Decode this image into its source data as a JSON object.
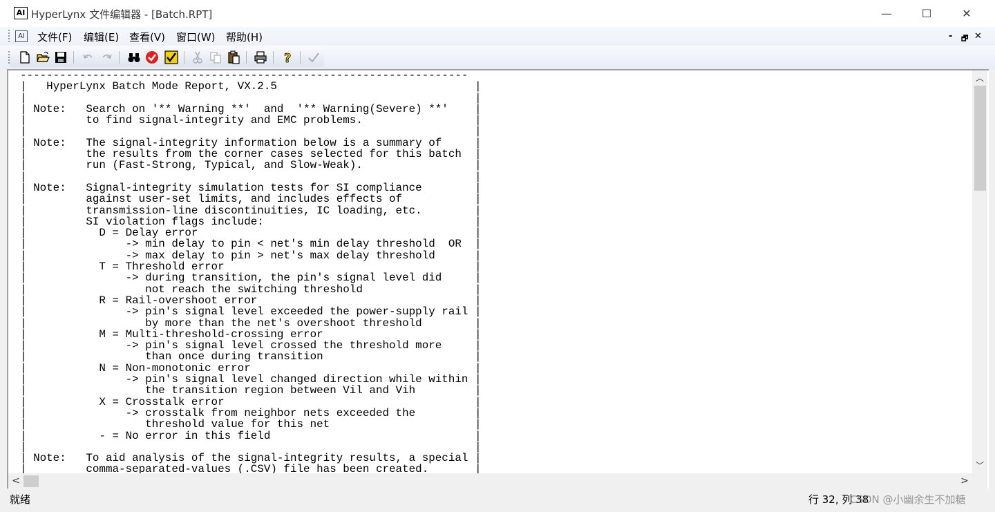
{
  "window": {
    "title": "HyperLynx 文件编辑器 - [Batch.RPT]",
    "app_icon_text": "AI",
    "min_glyph": "—",
    "max_glyph": "☐",
    "close_glyph": "✕"
  },
  "menubar": {
    "items": [
      "文件(F)",
      "编辑(E)",
      "查看(V)",
      "窗口(W)",
      "帮助(H)"
    ],
    "mdi_minimize": "-",
    "mdi_restore": "🗗",
    "mdi_close": "✕"
  },
  "toolbar": {
    "buttons": [
      "new",
      "open",
      "save",
      "undo",
      "redo",
      "find",
      "check",
      "select-check",
      "cut",
      "copy",
      "paste",
      "print",
      "help",
      "confirm"
    ]
  },
  "editor": {
    "lines": [
      "--------------------------------------------------------------------",
      "|   HyperLynx Batch Mode Report, VX.2.5                              |",
      "|                                                                    |",
      "| Note:   Search on '** Warning **'  and  '** Warning(Severe) **'    |",
      "|         to find signal-integrity and EMC problems.                 |",
      "|                                                                    |",
      "| Note:   The signal-integrity information below is a summary of     |",
      "|         the results from the corner cases selected for this batch  |",
      "|         run (Fast-Strong, Typical, and Slow-Weak).                 |",
      "|                                                                    |",
      "| Note:   Signal-integrity simulation tests for SI compliance        |",
      "|         against user-set limits, and includes effects of           |",
      "|         transmission-line discontinuities, IC loading, etc.        |",
      "|         SI violation flags include:                                |",
      "|           D = Delay error                                          |",
      "|               -> min delay to pin < net's min delay threshold  OR  |",
      "|               -> max delay to pin > net's max delay threshold      |",
      "|           T = Threshold error                                      |",
      "|               -> during transition, the pin's signal level did     |",
      "|                  not reach the switching threshold                 |",
      "|           R = Rail-overshoot error                                 |",
      "|               -> pin's signal level exceeded the power-supply rail |",
      "|                  by more than the net's overshoot threshold        |",
      "|           M = Multi-threshold-crossing error                       |",
      "|               -> pin's signal level crossed the threshold more     |",
      "|                  than once during transition                       |",
      "|           N = Non-monotonic error                                  |",
      "|               -> pin's signal level changed direction while within |",
      "|                  the transition region between Vil and Vih         |",
      "|           X = Crosstalk error                                      |",
      "|               -> crosstalk from neighbor nets exceeded the         |",
      "|                  threshold value for this net                      |",
      "|           - = No error in this field                               |",
      "|                                                                    |",
      "| Note:   To aid analysis of the signal-integrity results, a special |",
      "|         comma-separated-values (.CSV) file has been created.       |"
    ]
  },
  "scrollbars": {
    "up_arrow": "︿",
    "down_arrow": "﹀",
    "left_arrow": "<",
    "right_arrow": ">"
  },
  "statusbar": {
    "status": "就绪",
    "position": "行 32, 列 38",
    "watermark": "CSDN @小幽余生不加糖"
  },
  "colors": {
    "titlebar_bg": "#ffffff",
    "menubar_bg": "#eef2f8",
    "editor_bg": "#ffffff",
    "check_red": "#e02020",
    "select_yellow": "#f2d200"
  }
}
